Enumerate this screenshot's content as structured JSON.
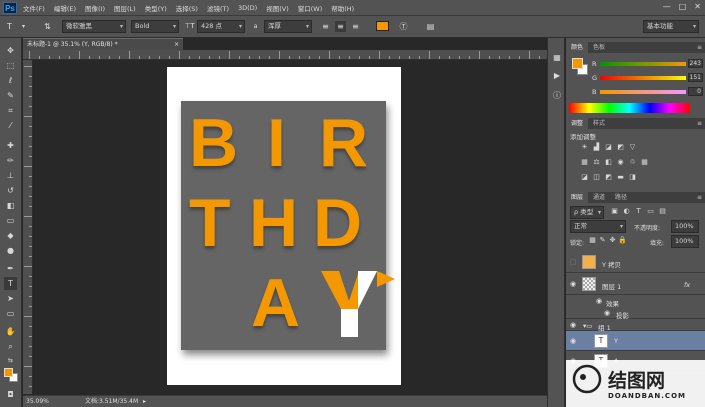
{
  "app": {
    "logo": "Ps"
  },
  "menubar": {
    "items": [
      "文件(F)",
      "编辑(E)",
      "图像(I)",
      "图层(L)",
      "类型(Y)",
      "选择(S)",
      "滤镜(T)",
      "3D(D)",
      "视图(V)",
      "窗口(W)",
      "帮助(H)"
    ],
    "window_controls": [
      "—",
      "□",
      "✕"
    ]
  },
  "options": {
    "tool_icon": "T",
    "font_family": "微软雅黑",
    "font_style": "Bold",
    "font_size": "428 点",
    "aa_label": "a",
    "aa_method": "浑厚",
    "text_color": "#f39800",
    "workspace": "基本功能"
  },
  "document": {
    "tab_title": "未标题-1 @ 35.1% (Y, RGB/8) *",
    "tab_close": "×",
    "zoom": "35.09%",
    "doc_info": "文档:3.51M/35.4M",
    "letters": [
      "B",
      "I",
      "R",
      "T",
      "H",
      "D",
      "A",
      "Y"
    ],
    "accent_color": "#f39800",
    "card_color": "#656565"
  },
  "color_panel": {
    "tabs": [
      "颜色",
      "色板"
    ],
    "channels": [
      {
        "label": "R",
        "value": "243"
      },
      {
        "label": "G",
        "value": "151"
      },
      {
        "label": "B",
        "value": "0"
      }
    ],
    "foreground": "#f39800"
  },
  "adjust_panel": {
    "tabs": [
      "调整",
      "样式"
    ],
    "title": "添加调整"
  },
  "layers_panel": {
    "tabs": [
      "图层",
      "通道",
      "路径"
    ],
    "filter_label": "ρ 类型",
    "blend_mode": "正常",
    "opacity_label": "不透明度:",
    "opacity": "100%",
    "lock_label": "锁定:",
    "fill_label": "填充:",
    "fill": "100%",
    "fx_label": "fx",
    "layers": [
      {
        "name": "Y 拷贝",
        "visible": false,
        "selected": false
      },
      {
        "name": "图层 1",
        "visible": true,
        "selected": false
      },
      {
        "name": "效果",
        "visible": true,
        "selected": false
      },
      {
        "name": "投影",
        "visible": true,
        "selected": false
      },
      {
        "name": "组 1",
        "visible": true,
        "selected": false
      },
      {
        "name": "Y",
        "visible": true,
        "selected": true
      },
      {
        "name": "A",
        "visible": true,
        "selected": false
      }
    ]
  },
  "watermark": {
    "brand": "结图网",
    "url": "DOANDBAN.COM"
  }
}
